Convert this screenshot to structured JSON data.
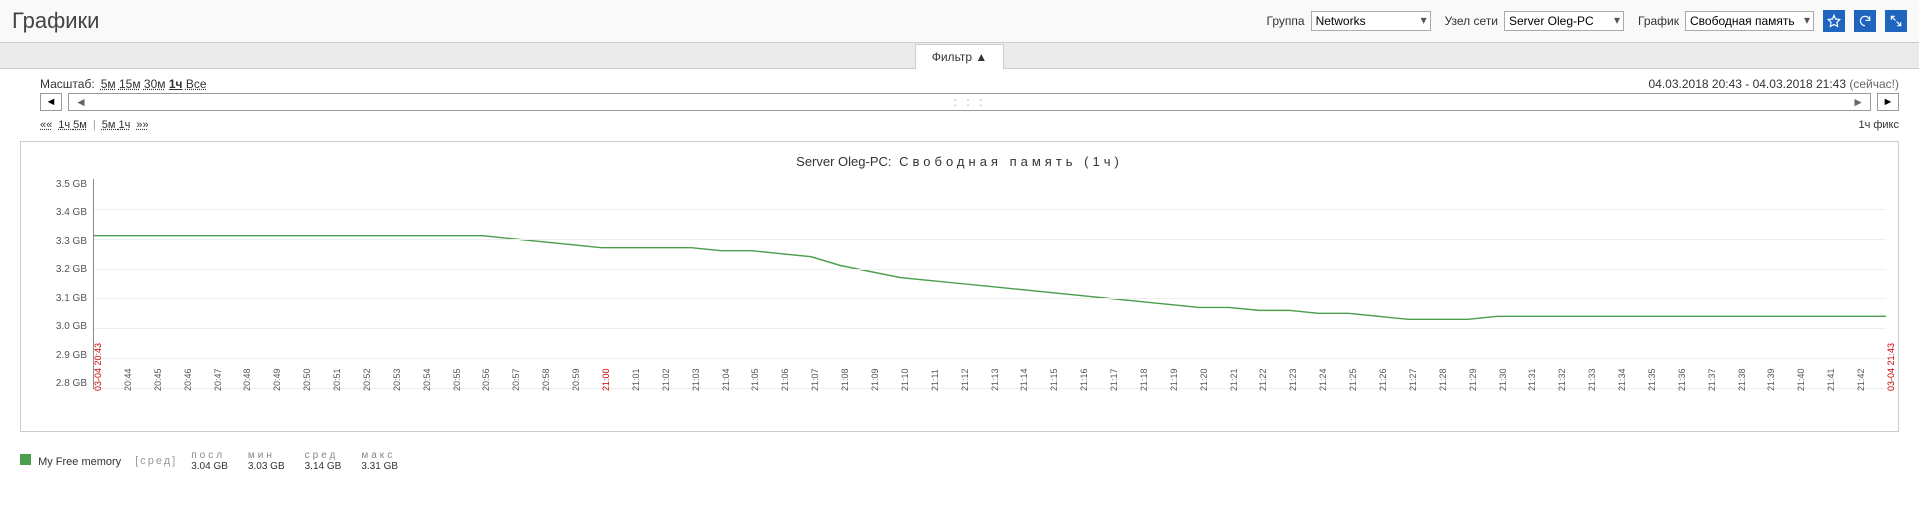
{
  "page": {
    "title": "Графики"
  },
  "header": {
    "group_label": "Группа",
    "group_value": "Networks",
    "host_label": "Узел сети",
    "host_value": "Server Oleg-PC",
    "graph_label": "График",
    "graph_value": "Свободная память"
  },
  "filter": {
    "label": "Фильтр ▲"
  },
  "zoom": {
    "label": "Масштаб:",
    "options": [
      "5м",
      "15м",
      "30м",
      "1ч",
      "Все"
    ],
    "active": "1ч"
  },
  "timerange": {
    "text": "04.03.2018 20:43 - 04.03.2018 21:43",
    "now": "(сейчас!)"
  },
  "quick_nav": {
    "prev_sym": "««",
    "items_left": [
      "1ч",
      "5м"
    ],
    "items_right": [
      "5м",
      "1ч"
    ],
    "next_sym": "»»",
    "fix": "1ч фикс"
  },
  "nav_arrows": {
    "left": "◄",
    "right": "►",
    "inner_left": "◄",
    "inner_right": "►"
  },
  "chart": {
    "title_host": "Server Oleg-PC:",
    "title_rest": "Свободная память (1ч)"
  },
  "legend": {
    "series_name": "My Free memory",
    "agg_label": "[сред]",
    "stats": [
      {
        "lbl": "посл",
        "val": "3.04 GB"
      },
      {
        "lbl": "мин",
        "val": "3.03 GB"
      },
      {
        "lbl": "сред",
        "val": "3.14 GB"
      },
      {
        "lbl": "макс",
        "val": "3.31 GB"
      }
    ]
  },
  "chart_data": {
    "type": "line",
    "title": "Server Oleg-PC: Свободная память (1ч)",
    "xlabel": "",
    "ylabel": "",
    "ylim": [
      2.8,
      3.5
    ],
    "y_ticks": [
      "3.5 GB",
      "3.4 GB",
      "3.3 GB",
      "3.2 GB",
      "3.1 GB",
      "3.0 GB",
      "2.9 GB",
      "2.8 GB"
    ],
    "x": [
      "20:43",
      "20:44",
      "20:45",
      "20:46",
      "20:47",
      "20:48",
      "20:49",
      "20:50",
      "20:51",
      "20:52",
      "20:53",
      "20:54",
      "20:55",
      "20:56",
      "20:57",
      "20:58",
      "20:59",
      "21:00",
      "21:01",
      "21:02",
      "21:03",
      "21:04",
      "21:05",
      "21:06",
      "21:07",
      "21:08",
      "21:09",
      "21:10",
      "21:11",
      "21:12",
      "21:13",
      "21:14",
      "21:15",
      "21:16",
      "21:17",
      "21:18",
      "21:19",
      "21:20",
      "21:21",
      "21:22",
      "21:23",
      "21:24",
      "21:25",
      "21:26",
      "21:27",
      "21:28",
      "21:29",
      "21:30",
      "21:31",
      "21:32",
      "21:33",
      "21:34",
      "21:35",
      "21:36",
      "21:37",
      "21:38",
      "21:39",
      "21:40",
      "21:41",
      "21:42",
      "21:43"
    ],
    "x_tick_special": {
      "start": "03-04 20:43",
      "end": "03-04 21:43",
      "hour": "21:00"
    },
    "series": [
      {
        "name": "My Free memory",
        "color": "#4c9e4c",
        "values": [
          3.31,
          3.31,
          3.31,
          3.31,
          3.31,
          3.31,
          3.31,
          3.31,
          3.31,
          3.31,
          3.31,
          3.31,
          3.31,
          3.31,
          3.3,
          3.29,
          3.28,
          3.27,
          3.27,
          3.27,
          3.27,
          3.26,
          3.26,
          3.25,
          3.24,
          3.21,
          3.19,
          3.17,
          3.16,
          3.15,
          3.14,
          3.13,
          3.12,
          3.11,
          3.1,
          3.09,
          3.08,
          3.07,
          3.07,
          3.06,
          3.06,
          3.05,
          3.05,
          3.04,
          3.03,
          3.03,
          3.03,
          3.04,
          3.04,
          3.04,
          3.04,
          3.04,
          3.04,
          3.04,
          3.04,
          3.04,
          3.04,
          3.04,
          3.04,
          3.04,
          3.04
        ]
      }
    ]
  }
}
